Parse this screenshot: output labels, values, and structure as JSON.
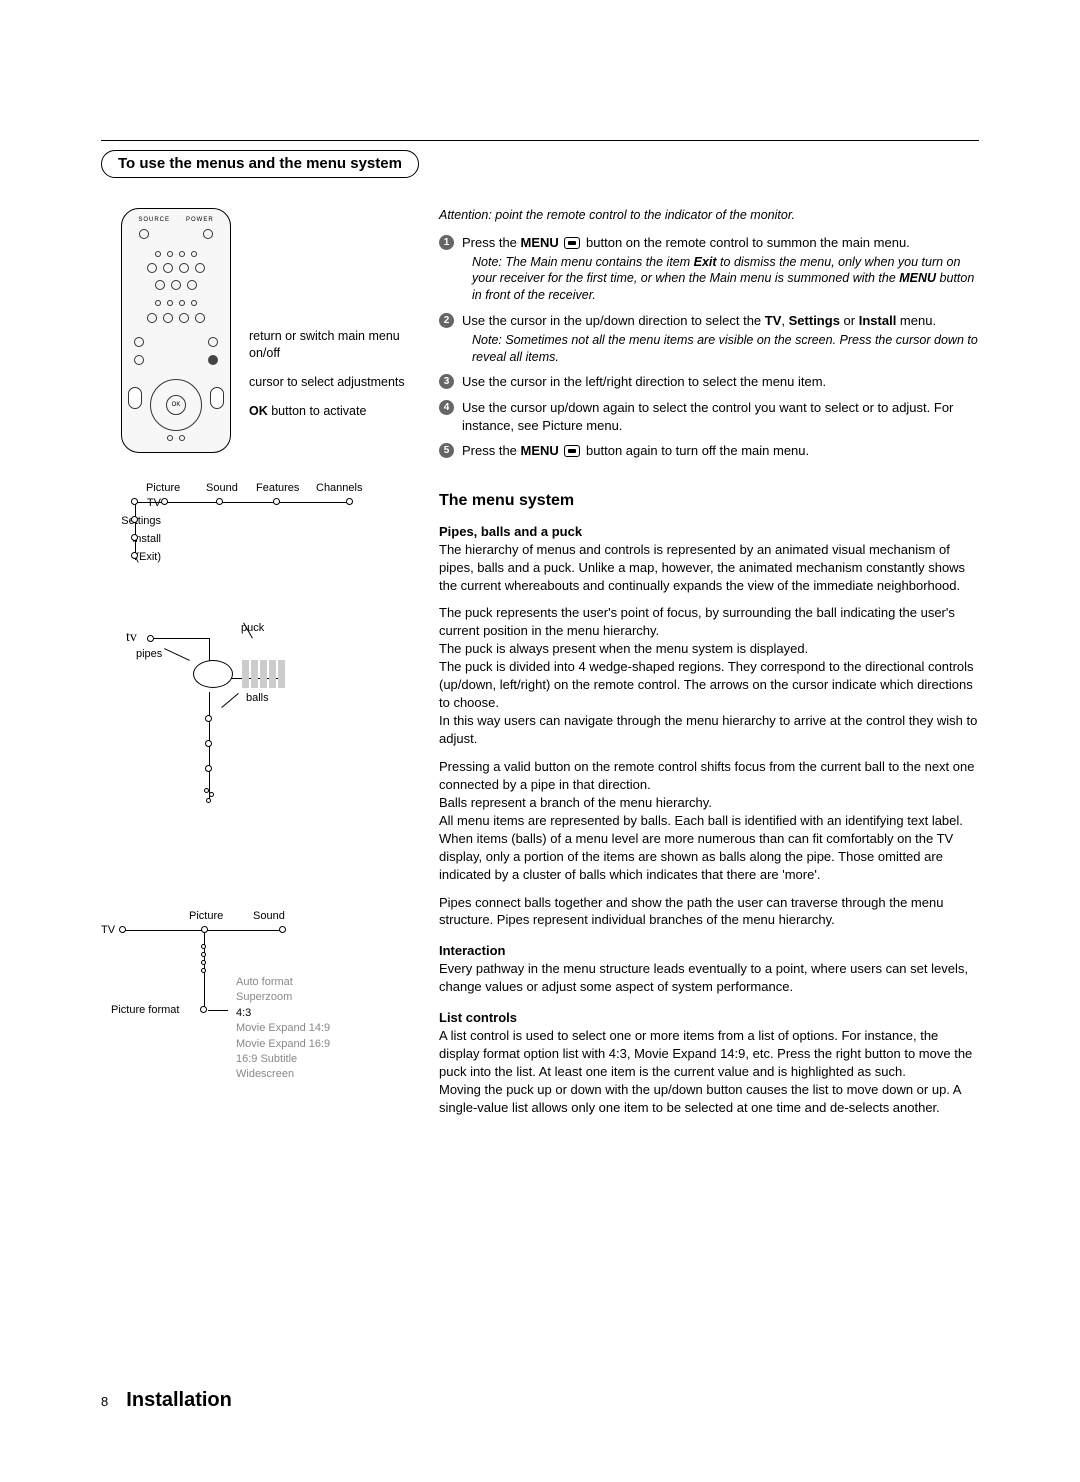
{
  "section_title": "To use the menus and the menu system",
  "attention": "Attention: point the remote control to the indicator of the monitor.",
  "steps": [
    {
      "n": "1",
      "before": "Press the ",
      "bold1": "MENU",
      "after1": " ",
      "icon": true,
      "after2": " button on the remote control to summon the main menu.",
      "note_plain": "Note: The Main menu contains the item ",
      "note_bi": "Exit",
      "note_tail": " to dismiss the menu, only when you turn on your receiver for the first time, or when the Main menu is summoned with the ",
      "note_bold2": "MENU",
      "note_tail2": " button in front of the receiver."
    },
    {
      "n": "2",
      "text": "Use the cursor in the up/down direction to select the ",
      "b1": "TV",
      "mid1": ", ",
      "b2": "Settings",
      "mid2": " or ",
      "b3": "Install",
      "tail": " menu.",
      "note": "Note: Sometimes not all the menu items are visible on the screen. Press the cursor down to reveal all items."
    },
    {
      "n": "3",
      "text": "Use the cursor in the left/right direction to select the menu item."
    },
    {
      "n": "4",
      "text": "Use the cursor up/down again to select the control you want to select or to adjust. For instance, see Picture menu."
    },
    {
      "n": "5",
      "before": "Press the ",
      "bold1": "MENU",
      "after1": " ",
      "icon": true,
      "after2": " button again to turn off the main menu."
    }
  ],
  "remote_labels": {
    "l1": "return or switch main menu on/off",
    "l2": "cursor to select adjustments",
    "l3_bold": "OK",
    "l3_rest": " button to activate"
  },
  "tree1": {
    "col_left": [
      "TV",
      "Settings",
      "Install",
      "(Exit)"
    ],
    "col_top": [
      "Picture",
      "Sound",
      "Features",
      "Channels"
    ]
  },
  "pipes_labels": {
    "tv": "tv",
    "puck": "puck",
    "pipes": "pipes",
    "balls": "balls"
  },
  "tree3": {
    "cols": [
      "Picture",
      "Sound"
    ],
    "tv": "TV",
    "pf": "Picture format",
    "options": [
      "Auto format",
      "Superzoom",
      "4:3",
      "Movie Expand 14:9",
      "Movie Expand 16:9",
      "16:9 Subtitle",
      "Widescreen"
    ],
    "selected_index": 2
  },
  "subhead": "The menu system",
  "pipes_heading": "Pipes, balls and a puck",
  "p1": "The hierarchy of menus and controls is represented by an animated visual mechanism of pipes, balls and a puck. Unlike a map, however, the animated mechanism constantly shows the current whereabouts and continually expands the view of the immediate neighborhood.",
  "p2": "The puck represents the user's point of focus, by surrounding the ball indicating the user's current position in the menu hierarchy.\nThe puck is always present when the menu system is displayed.\nThe puck is divided into 4 wedge-shaped regions. They correspond to the directional controls (up/down, left/right) on the remote control. The arrows on the cursor indicate which directions to choose.\nIn this way users can navigate through the menu hierarchy to arrive at the control they wish to adjust.",
  "p3": "Pressing a valid button on the remote control shifts focus from the current ball to the next one connected by a pipe in that direction.\nBalls represent a branch of the menu hierarchy.\nAll menu items are represented by balls. Each ball is identified with an identifying text label.  When items (balls) of a menu level are more numerous than can fit comfortably on the TV display, only a portion of the items are shown as balls along the pipe. Those omitted are indicated by a cluster of balls which indicates that there are 'more'.",
  "p4": "Pipes connect balls together and show the path the user can traverse through the menu structure. Pipes represent individual branches of the menu hierarchy.",
  "interaction_h": "Interaction",
  "p5": "Every pathway in the menu structure leads eventually to a point, where users can set levels, change values or adjust some aspect of system performance.",
  "list_h": "List controls",
  "p6": "A list control is used to select one or more items from a list of options. For instance, the display format option list with 4:3, Movie Expand 14:9, etc. Press the right button to move the puck into the list. At least one item is the current value and is highlighted as such.\nMoving the puck up or down with the up/down button causes the list to move down or up.  A single-value list allows only one item to be selected at one time and de-selects another.",
  "footer": {
    "page": "8",
    "title": "Installation"
  }
}
